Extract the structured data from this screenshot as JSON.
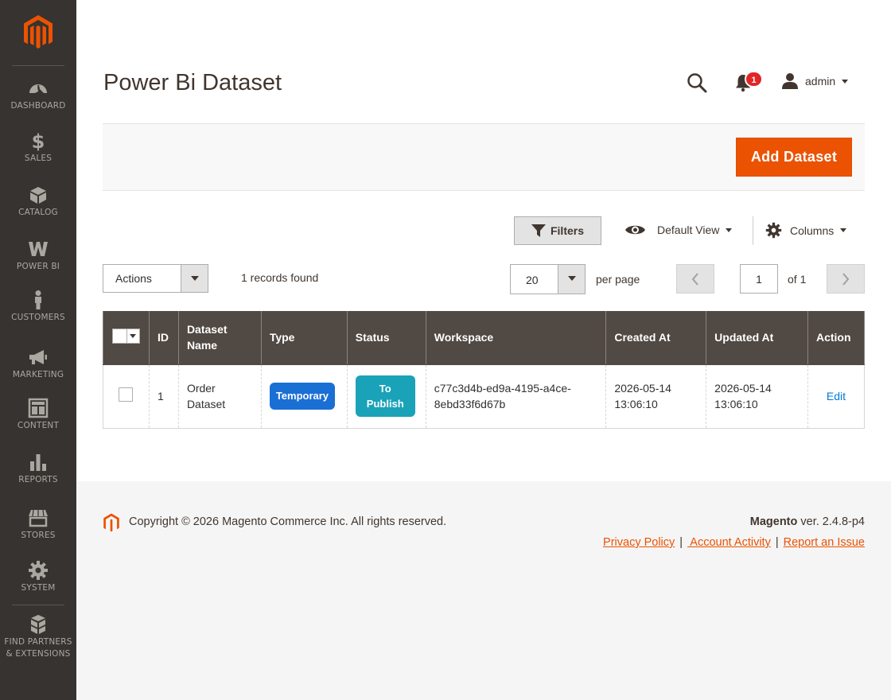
{
  "sidebar": {
    "items": [
      {
        "label": "DASHBOARD",
        "icon": "dashboard-icon"
      },
      {
        "label": "SALES",
        "icon": "dollar-icon"
      },
      {
        "label": "CATALOG",
        "icon": "box-icon"
      },
      {
        "label": "POWER BI",
        "icon": "power-bi-icon"
      },
      {
        "label": "CUSTOMERS",
        "icon": "person-icon"
      },
      {
        "label": "MARKETING",
        "icon": "megaphone-icon"
      },
      {
        "label": "CONTENT",
        "icon": "layout-icon"
      },
      {
        "label": "REPORTS",
        "icon": "bar-chart-icon"
      },
      {
        "label": "STORES",
        "icon": "storefront-icon"
      },
      {
        "label": "SYSTEM",
        "icon": "gear-icon"
      },
      {
        "label": "FIND PARTNERS",
        "label2": "& EXTENSIONS",
        "icon": "cubes-icon"
      }
    ]
  },
  "header": {
    "title": "Power Bi Dataset",
    "notifications_count": "1",
    "user_name": "admin"
  },
  "toolbar": {
    "add_label": "Add Dataset"
  },
  "grid_controls": {
    "filters_label": "Filters",
    "view_label": "Default View",
    "columns_label": "Columns",
    "actions_label": "Actions",
    "records_found": "1 records found",
    "per_page_value": "20",
    "per_page_label": "per page",
    "current_page": "1",
    "page_total": "of 1"
  },
  "table": {
    "headers": [
      "ID",
      "Dataset Name",
      "Type",
      "Status",
      "Workspace",
      "Created At",
      "Updated At",
      "Action"
    ],
    "rows": [
      {
        "id": "1",
        "name_line1": "Order",
        "name_line2": "Dataset",
        "type": "Temporary",
        "status_line1": "To",
        "status_line2": "Publish",
        "workspace_line1": "c77c3d4b-ed9a-4195-a4ce-",
        "workspace_line2": "8ebd33f6d67b",
        "created_date": "2026-05-14",
        "created_time": "13:06:10",
        "updated_date": "2026-05-14",
        "updated_time": "13:06:10",
        "action": "Edit"
      }
    ]
  },
  "footer": {
    "copyright": "Copyright © 2026 Magento Commerce Inc. All rights reserved.",
    "brand": "Magento",
    "version": " ver. 2.4.8-p4",
    "links": [
      "Privacy Policy",
      " Account Activity",
      "Report an Issue"
    ]
  },
  "colors": {
    "sidebar_bg": "#373330",
    "accent": "#eb5202",
    "grid_header": "#514943",
    "badge_type": "#1a6fd4",
    "badge_status": "#1aa2b8",
    "link": "#007bdb"
  }
}
